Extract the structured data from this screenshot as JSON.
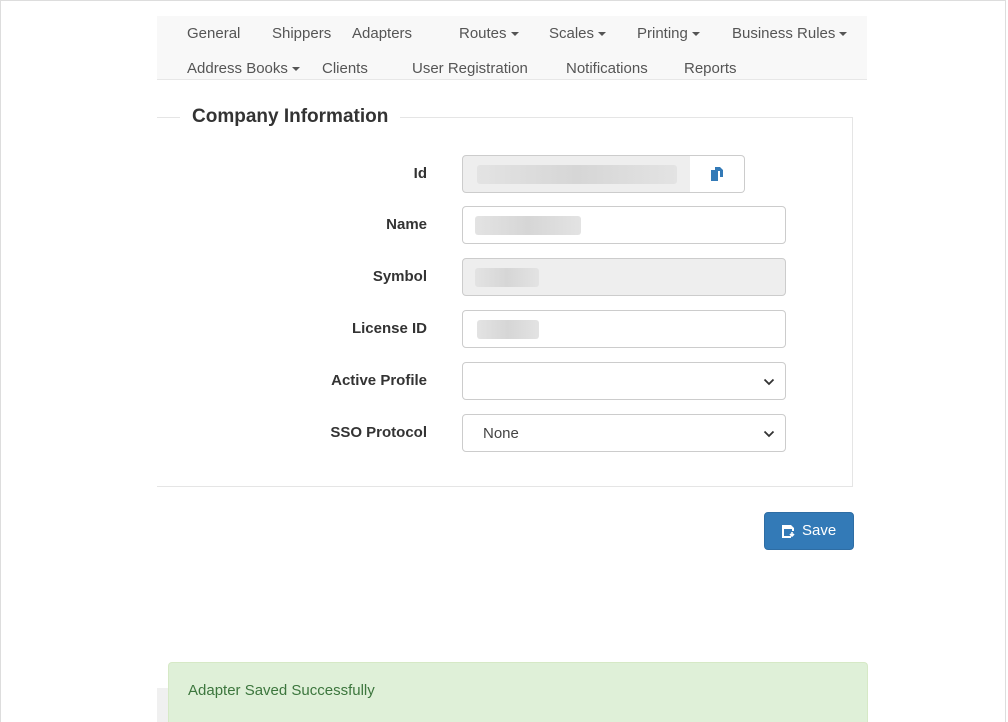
{
  "nav": {
    "row1": [
      {
        "label": "General",
        "dropdown": false
      },
      {
        "label": "Shippers",
        "dropdown": false
      },
      {
        "label": "Adapters",
        "dropdown": false
      },
      {
        "label": "Routes",
        "dropdown": true
      },
      {
        "label": "Scales",
        "dropdown": true
      },
      {
        "label": "Printing",
        "dropdown": true
      },
      {
        "label": "Business Rules",
        "dropdown": true
      }
    ],
    "row2": [
      {
        "label": "Address Books",
        "dropdown": true
      },
      {
        "label": "Clients",
        "dropdown": false
      },
      {
        "label": "User Registration",
        "dropdown": false
      },
      {
        "label": "Notifications",
        "dropdown": false
      },
      {
        "label": "Reports",
        "dropdown": false
      }
    ]
  },
  "form": {
    "legend": "Company Information",
    "fields": {
      "id": {
        "label": "Id",
        "value": ""
      },
      "name": {
        "label": "Name",
        "value": ""
      },
      "symbol": {
        "label": "Symbol",
        "value": ""
      },
      "license": {
        "label": "License ID",
        "value": ""
      },
      "active_profile": {
        "label": "Active Profile",
        "value": ""
      },
      "sso_protocol": {
        "label": "SSO Protocol",
        "value": "None"
      }
    }
  },
  "buttons": {
    "save_label": "Save",
    "copy_icon": "copy-icon",
    "save_icon": "floppy-save-icon"
  },
  "alert": {
    "text": "Adapter Saved Successfully"
  },
  "colors": {
    "primary": "#337ab7",
    "alert_bg": "#dff0d8",
    "alert_text": "#3c763d",
    "nav_bg": "#f8f8f8"
  }
}
